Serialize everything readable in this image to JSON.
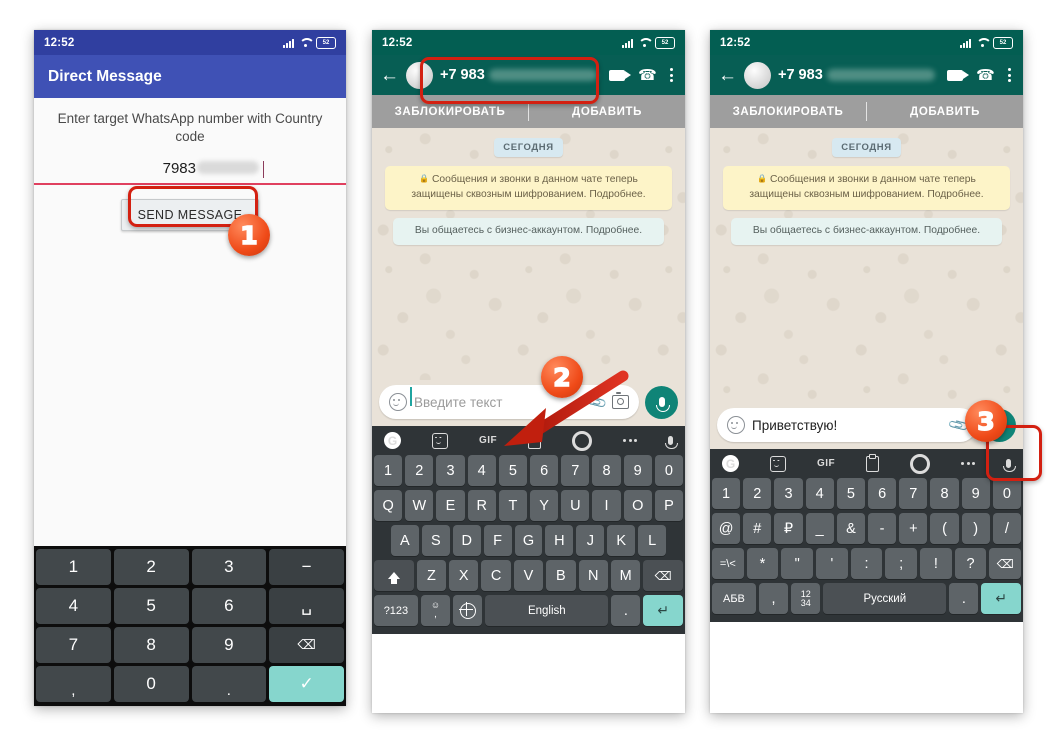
{
  "phone1": {
    "status": {
      "clock": "12:52",
      "battery": "52",
      "icons": [
        "signal-icon",
        "wifi-icon",
        "battery-icon"
      ]
    },
    "appbar": {
      "title": "Direct Message"
    },
    "hint": "Enter target WhatsApp number with Country code",
    "number_input": {
      "value": "7983",
      "masked": true
    },
    "send_button": "SEND MESSAGE",
    "keypad": {
      "rows": [
        [
          "1",
          "2",
          "3",
          "−"
        ],
        [
          "4",
          "5",
          "6",
          "␣"
        ],
        [
          "7",
          "8",
          "9",
          "⌫"
        ],
        [
          ",",
          "0",
          ".",
          "✓"
        ]
      ]
    }
  },
  "phone2": {
    "status": {
      "clock": "12:52",
      "battery": "52"
    },
    "appbar": {
      "number": "+7 983",
      "masked": true,
      "actions": [
        "video-call-icon",
        "voice-call-icon",
        "overflow-menu-icon"
      ]
    },
    "biz_actions": {
      "block": "ЗАБЛОКИРОВАТЬ",
      "add": "ДОБАВИТЬ"
    },
    "date_chip": "СЕГОДНЯ",
    "encryption_notice": "Сообщения и звонки в данном чате теперь защищены сквозным шифрованием. Подробнее.",
    "business_notice": "Вы общаетесь с бизнес-аккаунтом. Подробнее.",
    "input": {
      "placeholder": "Введите текст",
      "value": ""
    },
    "keyboard": {
      "toolbar": [
        "google-icon",
        "sticker-icon",
        "GIF",
        "clipboard-icon",
        "settings-icon",
        "more-icon",
        "mic-icon"
      ],
      "row1": [
        "1",
        "2",
        "3",
        "4",
        "5",
        "6",
        "7",
        "8",
        "9",
        "0"
      ],
      "row2": [
        "Q",
        "W",
        "E",
        "R",
        "T",
        "Y",
        "U",
        "I",
        "O",
        "P"
      ],
      "row3": [
        "A",
        "S",
        "D",
        "F",
        "G",
        "H",
        "J",
        "K",
        "L"
      ],
      "row4": [
        "Z",
        "X",
        "C",
        "V",
        "B",
        "N",
        "M"
      ],
      "symbols_key": "?123",
      "emoji_key_top": "☺",
      "emoji_key_bottom": ",",
      "language_key": "globe-icon",
      "space_label": "English",
      "period_key": ".",
      "enter_key": "↵"
    }
  },
  "phone3": {
    "status": {
      "clock": "12:52",
      "battery": "52"
    },
    "appbar": {
      "number": "+7 983",
      "masked": true
    },
    "biz_actions": {
      "block": "ЗАБЛОКИРОВАТЬ",
      "add": "ДОБАВИТЬ"
    },
    "date_chip": "СЕГОДНЯ",
    "encryption_notice": "Сообщения и звонки в данном чате теперь защищены сквозным шифрованием. Подробнее.",
    "business_notice": "Вы общаетесь с бизнес-аккаунтом. Подробнее.",
    "input": {
      "value": "Приветствую!"
    },
    "keyboard": {
      "row1": [
        "1",
        "2",
        "3",
        "4",
        "5",
        "6",
        "7",
        "8",
        "9",
        "0"
      ],
      "row2": [
        "@",
        "#",
        "₽",
        "_",
        "&",
        "-",
        "+",
        "(",
        ")",
        "/"
      ],
      "row3": [
        "=\\<",
        "*",
        "\"",
        "'",
        ":",
        ";",
        "!",
        "?",
        "⌫"
      ],
      "alpha_key": "АБВ",
      "comma_key": ",",
      "num_key_top": "12",
      "num_key_bottom": "34",
      "space_label": "Русский",
      "period_key": ".",
      "enter_key": "↵"
    }
  },
  "annotations": {
    "step1": "1",
    "step2": "2",
    "step3": "3"
  },
  "colors": {
    "app_blue": "#3f51b5",
    "whatsapp_green": "#075e54",
    "accent_red": "#d32011",
    "badge_orange": "#ef4a18",
    "chat_bg": "#e9e2d8",
    "key_teal": "#86d6cd"
  }
}
